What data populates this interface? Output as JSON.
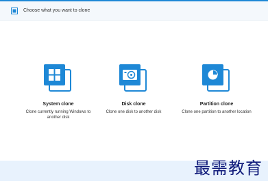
{
  "header": {
    "title": "Choose what you want to clone"
  },
  "icons": {
    "header": "clone-icon",
    "system_clone": "windows-logo-icon",
    "disk_clone": "disk-icon",
    "partition_clone": "pie-chart-icon"
  },
  "colors": {
    "accent": "#1e88d6",
    "header_bg": "#f4f8fc",
    "footer_bg": "#e8f2fd",
    "watermark": "#0f1a7a"
  },
  "options": [
    {
      "title": "System clone",
      "description": "Clone currently running Windows to another disk"
    },
    {
      "title": "Disk clone",
      "description": "Clone one disk to another disk"
    },
    {
      "title": "Partition clone",
      "description": "Clone one partition to another location"
    }
  ],
  "watermark": {
    "text": "最需教育"
  }
}
